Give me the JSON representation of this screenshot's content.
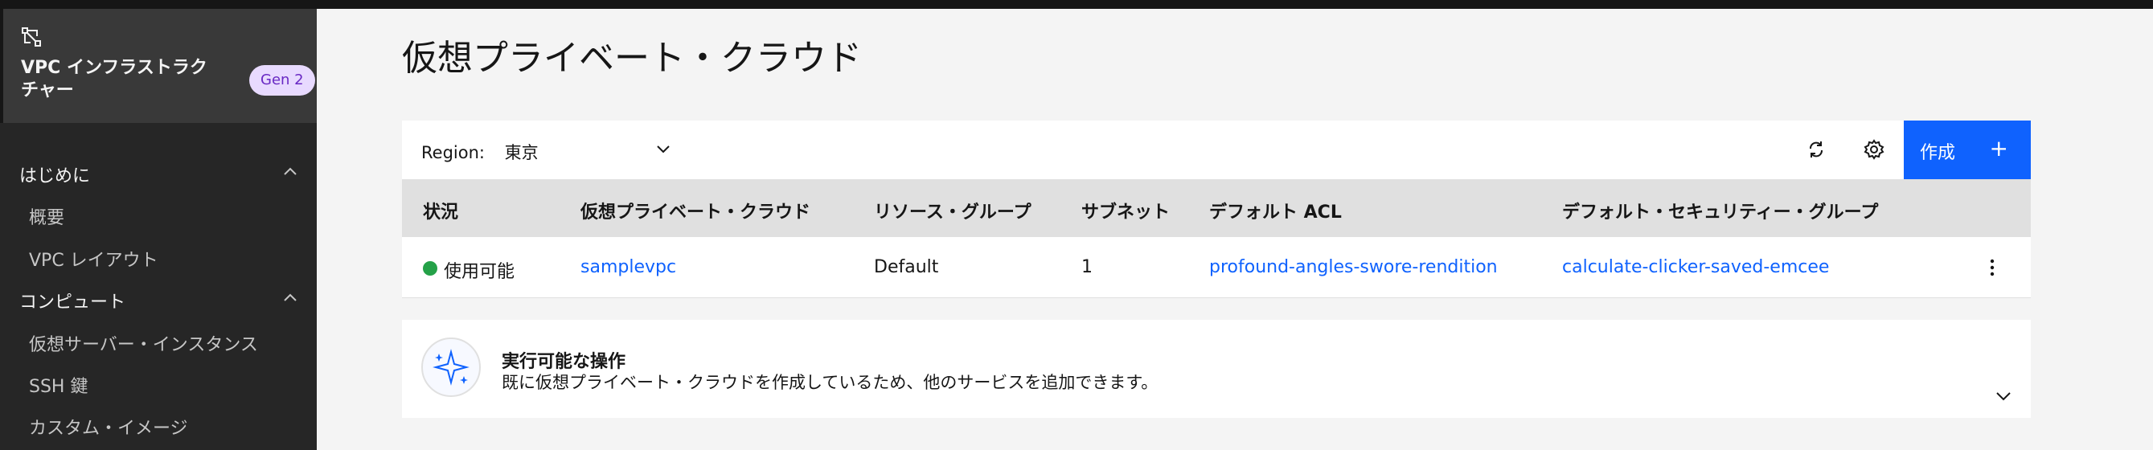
{
  "sidebar": {
    "title": "VPC インフラストラクチャー",
    "badge": "Gen 2",
    "sections": [
      {
        "label": "はじめに",
        "items": [
          "概要",
          "VPC レイアウト"
        ]
      },
      {
        "label": "コンピュート",
        "items": [
          "仮想サーバー・インスタンス",
          "SSH 鍵",
          "カスタム・イメージ"
        ]
      }
    ]
  },
  "page": {
    "title": "仮想プライベート・クラウド"
  },
  "toolbar": {
    "region_label": "Region:",
    "region_value": "東京",
    "create_label": "作成",
    "create_plus": "+",
    "icons": [
      "refresh-icon",
      "settings-icon",
      "add-icon"
    ]
  },
  "table": {
    "columns": [
      "状況",
      "仮想プライベート・クラウド",
      "リソース・グループ",
      "サブネット",
      "デフォルト ACL",
      "デフォルト・セキュリティー・グループ"
    ],
    "rows": [
      {
        "status": "使用可能",
        "status_color": "#24a148",
        "vpc": "samplevpc",
        "resource_group": "Default",
        "subnets": "1",
        "default_acl": "profound-angles-swore-rendition",
        "default_sg": "calculate-clicker-saved-emcee"
      }
    ]
  },
  "actions": {
    "title": "実行可能な操作",
    "description": "既に仮想プライベート・クラウドを作成しているため、他のサービスを追加できます。"
  },
  "colors": {
    "accent": "#0f62fe",
    "sidebar_bg": "#262626",
    "badge_bg": "#e8daff",
    "badge_text": "#6929c4"
  }
}
